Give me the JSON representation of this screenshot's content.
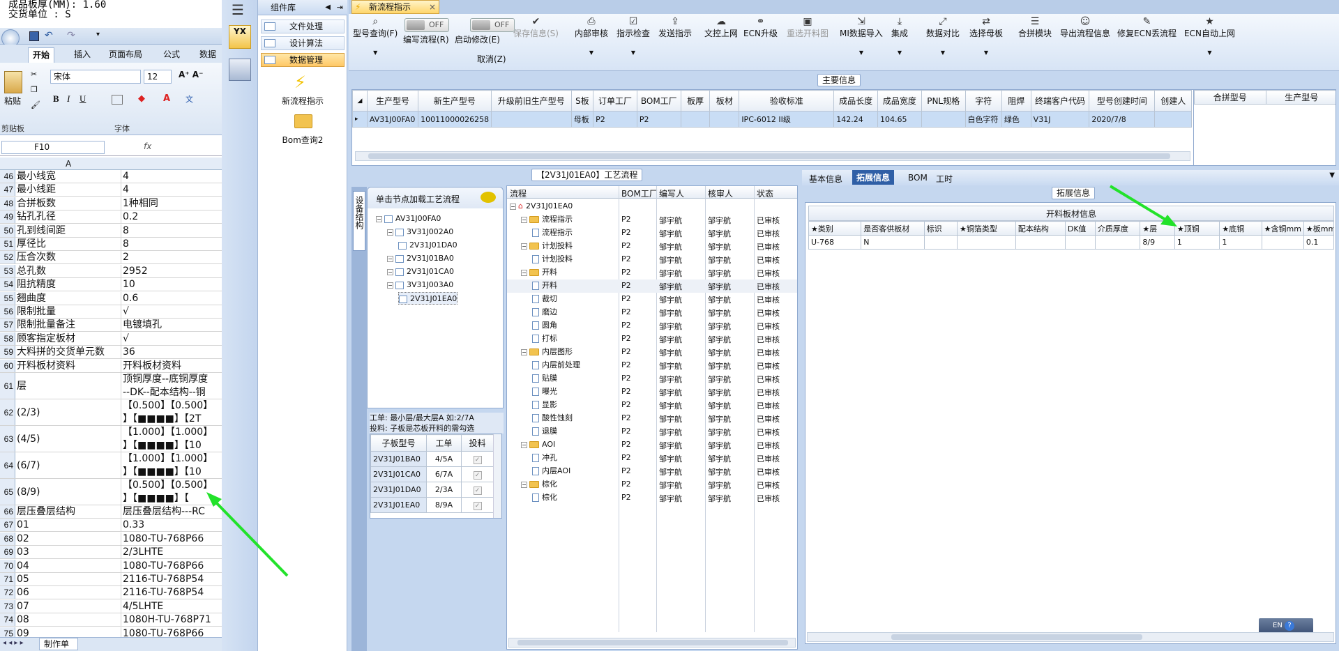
{
  "excel": {
    "top_lines": [
      "成品板厚(MM): 1.60",
      "交货单位 : S"
    ],
    "tabs": [
      "开始",
      "插入",
      "页面布局",
      "公式",
      "数据"
    ],
    "font_name": "宋体",
    "font_size": "12",
    "clipboard_group": "剪贴板",
    "font_group": "字体",
    "paste_label": "粘贴",
    "name_box": "F10",
    "fx_label": "fx",
    "col_header": "A",
    "rows": [
      {
        "n": "46",
        "a": "最小线宽",
        "b": "4"
      },
      {
        "n": "47",
        "a": "最小线距",
        "b": "4"
      },
      {
        "n": "48",
        "a": "合拼板数",
        "b": "1种相同"
      },
      {
        "n": "49",
        "a": "钻孔孔径",
        "b": "0.2"
      },
      {
        "n": "50",
        "a": "孔到线间距",
        "b": "8"
      },
      {
        "n": "51",
        "a": "厚径比",
        "b": "8"
      },
      {
        "n": "52",
        "a": "压合次数",
        "b": "2"
      },
      {
        "n": "53",
        "a": "总孔数",
        "b": "2952"
      },
      {
        "n": "54",
        "a": "阻抗精度",
        "b": "10"
      },
      {
        "n": "55",
        "a": "翘曲度",
        "b": "0.6"
      },
      {
        "n": "56",
        "a": "限制批量",
        "b": "√"
      },
      {
        "n": "57",
        "a": "限制批量备注",
        "b": "电镀填孔"
      },
      {
        "n": "58",
        "a": "顾客指定板材",
        "b": "√"
      },
      {
        "n": "59",
        "a": "大料拼的交货单元数",
        "b": "36"
      },
      {
        "n": "60",
        "a": "开料板材资料",
        "b": "开料板材资料"
      }
    ],
    "tall_rows": [
      {
        "n": "61",
        "a": "层",
        "b1": "顶铜厚度--底铜厚度",
        "b2": "--DK--配本结构--铜"
      },
      {
        "n": "62",
        "a": "(2/3)",
        "b1": "【0.500】【0.500】",
        "b2": "】【■■■■】【2T"
      },
      {
        "n": "63",
        "a": "(4/5)",
        "b1": "【1.000】【1.000】",
        "b2": "】【■■■■】【10"
      },
      {
        "n": "64",
        "a": "(6/7)",
        "b1": "【1.000】【1.000】",
        "b2": "】【■■■■】【10"
      },
      {
        "n": "65",
        "a": "(8/9)",
        "b1": "【0.500】【0.500】",
        "b2": "】【■■■■】【"
      }
    ],
    "rows2": [
      {
        "n": "66",
        "a": "层压叠层结构",
        "b": "层压叠层结构---RC"
      },
      {
        "n": "67",
        "a": "01",
        "b": "0.33"
      },
      {
        "n": "68",
        "a": "02",
        "b": "1080-TU-768P66"
      },
      {
        "n": "69",
        "a": "03",
        "b": "2/3LHTE"
      },
      {
        "n": "70",
        "a": "04",
        "b": "1080-TU-768P66"
      },
      {
        "n": "71",
        "a": "05",
        "b": "2116-TU-768P54"
      },
      {
        "n": "72",
        "a": "06",
        "b": "2116-TU-768P54"
      },
      {
        "n": "73",
        "a": "07",
        "b": "4/5LHTE"
      },
      {
        "n": "74",
        "a": "08",
        "b": "1080H-TU-768P71"
      },
      {
        "n": "75",
        "a": "09",
        "b": "1080-TU-768P66"
      },
      {
        "n": "76",
        "a": "10",
        "b": "1080-TU-768P66"
      }
    ],
    "sheet_tab": "制作单"
  },
  "app": {
    "component_lib": "组件库",
    "yx_label": "YX",
    "lib_items": [
      "文件处理",
      "设计算法",
      "数据管理"
    ],
    "new_flow": "新流程指示",
    "bom_query": "Bom查询2",
    "doc_tab": "新流程指示",
    "toolbar": [
      {
        "label": "型号查询(F)",
        "icon": "search-icon",
        "dis": false,
        "dd": true
      },
      {
        "label": "编写流程(R)",
        "icon": "toggle",
        "dis": false
      },
      {
        "label": "启动修改(E)",
        "icon": "toggle",
        "dis": false
      },
      {
        "label": "保存信息(S)",
        "icon": "check-icon",
        "dis": true
      },
      {
        "label": "内部审核",
        "icon": "printer-icon",
        "dis": false,
        "dd": true
      },
      {
        "label": "指示检查",
        "icon": "checkbox-icon",
        "dis": false,
        "dd": true
      },
      {
        "label": "发送指示",
        "icon": "upload-icon",
        "dis": false
      },
      {
        "label": "文控上网",
        "icon": "cloud-upload-icon",
        "dis": false
      },
      {
        "label": "ECN升级",
        "icon": "binoculars-icon",
        "dis": false
      },
      {
        "label": "重选开料图",
        "icon": "image-icon",
        "dis": true
      },
      {
        "label": "MI数据导入",
        "icon": "import-icon",
        "dis": false,
        "dd": true
      },
      {
        "label": "集成",
        "icon": "download-icon",
        "dis": false,
        "dd": true
      },
      {
        "label": "数据对比",
        "icon": "compare-icon",
        "dis": false,
        "dd": true
      },
      {
        "label": "选择母板",
        "icon": "shuffle-icon",
        "dis": false,
        "dd": true
      },
      {
        "label": "合拼模块",
        "icon": "list-icon",
        "dis": false
      },
      {
        "label": "导出流程信息",
        "icon": "smile-icon",
        "dis": false
      },
      {
        "label": "修复ECN丢流程",
        "icon": "wrench-icon",
        "dis": false
      },
      {
        "label": "ECN自动上网",
        "icon": "star-icon",
        "dis": false,
        "dd": true
      }
    ],
    "toggle_off": "OFF",
    "cancel_label": "取消(Z)",
    "main_info_title": "主要信息",
    "main_headers": [
      "生产型号",
      "新生产型号",
      "升级前旧生产型号",
      "S板",
      "订单工厂",
      "BOM工厂",
      "板厚",
      "板材",
      "验收标准",
      "成品长度",
      "成品宽度",
      "PNL规格",
      "字符",
      "阻焊",
      "终端客户代码",
      "型号创建时间",
      "创建人"
    ],
    "main_row": [
      "AV31J00FA0",
      "10011000026258",
      "",
      "母板",
      "P2",
      "P2",
      "",
      "",
      "IPC-6012 II级",
      "142.24",
      "104.65",
      "",
      "白色字符",
      "绿色",
      "V31J",
      "2020/7/8",
      ""
    ],
    "side_headers": [
      "合拼型号",
      "生产型号"
    ],
    "flow_title": "【2V31J01EA0】工艺流程",
    "device_tab": "设备结构",
    "tree_hint": "单击节点加载工艺流程",
    "tree_nodes": [
      {
        "label": "AV31J00FA0",
        "lvl": 0
      },
      {
        "label": "3V31J002A0",
        "lvl": 1
      },
      {
        "label": "2V31J01DA0",
        "lvl": 2
      },
      {
        "label": "2V31J01BA0",
        "lvl": 1
      },
      {
        "label": "2V31J01CA0",
        "lvl": 1
      },
      {
        "label": "3V31J003A0",
        "lvl": 1
      },
      {
        "label": "2V31J01EA0",
        "lvl": 2
      }
    ],
    "note1": "工单: 最小层/最大层A 如:2/7A",
    "note2": "投料: 子板是芯板开料的需勾选",
    "sub_headers": [
      "子板型号",
      "工单",
      "投料"
    ],
    "sub_rows": [
      {
        "model": "2V31J01BA0",
        "order": "4/5A"
      },
      {
        "model": "2V31J01CA0",
        "order": "6/7A"
      },
      {
        "model": "2V31J01DA0",
        "order": "2/3A"
      },
      {
        "model": "2V31J01EA0",
        "order": "8/9A"
      }
    ],
    "flow_headers": [
      "流程",
      "BOM工厂",
      "编写人",
      "核审人",
      "状态"
    ],
    "flow_root": "2V31J01EA0",
    "flow_rows": [
      {
        "name": "流程指示",
        "type": "folder",
        "lvl": 1
      },
      {
        "name": "流程指示",
        "type": "doc",
        "lvl": 2
      },
      {
        "name": "计划投料",
        "type": "folder",
        "lvl": 1
      },
      {
        "name": "计划投料",
        "type": "doc",
        "lvl": 2
      },
      {
        "name": "开料",
        "type": "folder",
        "lvl": 1
      },
      {
        "name": "开料",
        "type": "doc",
        "lvl": 2
      },
      {
        "name": "裁切",
        "type": "doc",
        "lvl": 2
      },
      {
        "name": "磨边",
        "type": "doc",
        "lvl": 2
      },
      {
        "name": "圆角",
        "type": "doc",
        "lvl": 2
      },
      {
        "name": "打标",
        "type": "doc",
        "lvl": 2
      },
      {
        "name": "内层图形",
        "type": "folder",
        "lvl": 1
      },
      {
        "name": "内层前处理",
        "type": "doc",
        "lvl": 2
      },
      {
        "name": "贴膜",
        "type": "doc",
        "lvl": 2
      },
      {
        "name": "曝光",
        "type": "doc",
        "lvl": 2
      },
      {
        "name": "显影",
        "type": "doc",
        "lvl": 2
      },
      {
        "name": "酸性蚀刻",
        "type": "doc",
        "lvl": 2
      },
      {
        "name": "退膜",
        "type": "doc",
        "lvl": 2
      },
      {
        "name": "AOI",
        "type": "folder",
        "lvl": 1
      },
      {
        "name": "冲孔",
        "type": "doc",
        "lvl": 2
      },
      {
        "name": "内层AOI",
        "type": "doc",
        "lvl": 2
      },
      {
        "name": "棕化",
        "type": "folder",
        "lvl": 1
      },
      {
        "name": "棕化",
        "type": "doc",
        "lvl": 2
      }
    ],
    "flow_factory": "P2",
    "flow_writer": "邹宇航",
    "flow_checker": "邹宇航",
    "flow_status": "已审核",
    "info_tabs": [
      "基本信息",
      "拓展信息",
      "BOM",
      "工时"
    ],
    "ext_title": "拓展信息",
    "kl_title": "开料板材信息",
    "kl_headers": [
      "★类别",
      "是否客供板材",
      "标识",
      "★铜箔类型",
      "配本结构",
      "DK值",
      "介质厚度",
      "★层",
      "★顶铜",
      "★底铜",
      "★含铜mm",
      "★板mm"
    ],
    "kl_row": [
      "U-768",
      "N",
      "",
      "",
      "",
      "",
      "",
      "8/9",
      "1",
      "1",
      "",
      "0.1"
    ],
    "lang": "EN"
  }
}
